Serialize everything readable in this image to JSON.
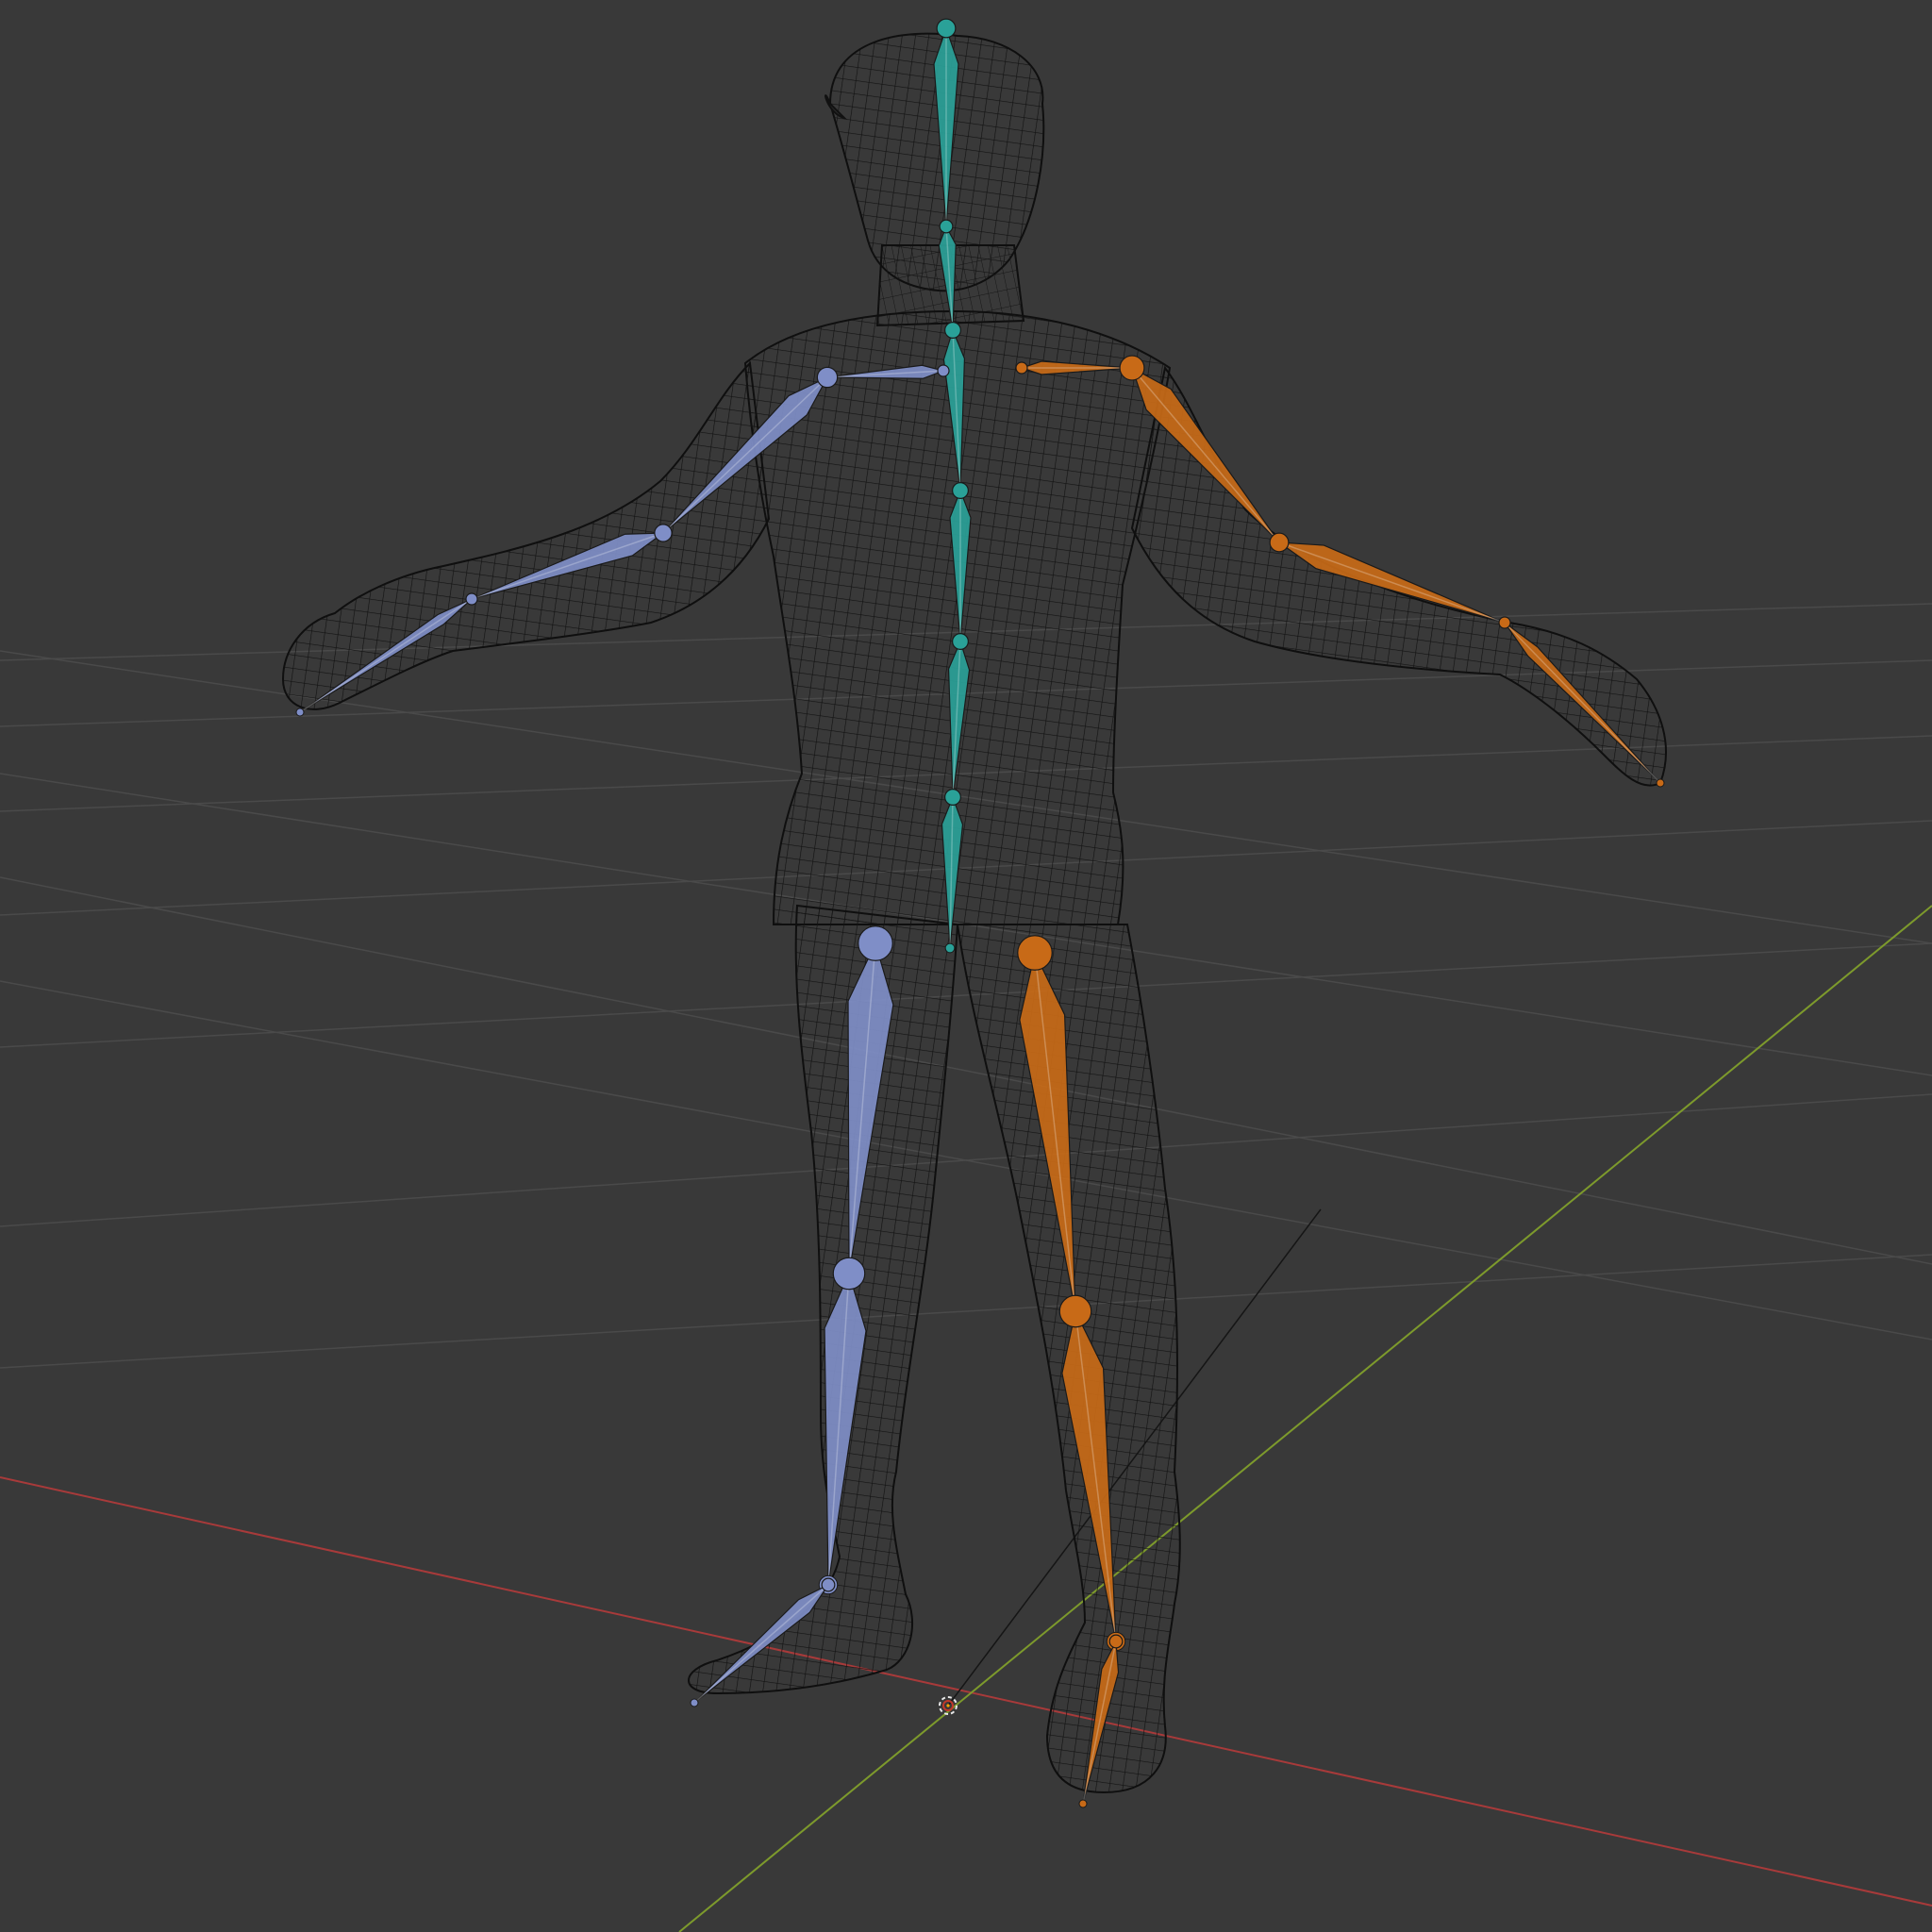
{
  "viewport": {
    "background_color": "#393939",
    "grid_color": "#4a4a4a",
    "x_axis_color": "#a83a3a",
    "y_axis_color": "#7d9a2c"
  },
  "mesh": {
    "display": "wireframe",
    "wire_color": "#111111"
  },
  "armature": {
    "center_bone_color": "#2aa198",
    "left_side_color": "#7f8ec7",
    "right_side_color": "#c86a17",
    "bones": [
      {
        "id": "head",
        "group": "center"
      },
      {
        "id": "neck",
        "group": "center"
      },
      {
        "id": "spine-upper",
        "group": "center"
      },
      {
        "id": "spine-mid",
        "group": "center"
      },
      {
        "id": "spine-lower",
        "group": "center"
      },
      {
        "id": "hips",
        "group": "center"
      },
      {
        "id": "shoulder-l",
        "group": "left"
      },
      {
        "id": "upper-arm-l",
        "group": "left"
      },
      {
        "id": "forearm-l",
        "group": "left"
      },
      {
        "id": "hand-l",
        "group": "left"
      },
      {
        "id": "thigh-l",
        "group": "left"
      },
      {
        "id": "shin-l",
        "group": "left"
      },
      {
        "id": "foot-l",
        "group": "left"
      },
      {
        "id": "shoulder-r",
        "group": "right"
      },
      {
        "id": "upper-arm-r",
        "group": "right"
      },
      {
        "id": "forearm-r",
        "group": "right"
      },
      {
        "id": "hand-r",
        "group": "right"
      },
      {
        "id": "thigh-r",
        "group": "right"
      },
      {
        "id": "shin-r",
        "group": "right"
      },
      {
        "id": "foot-r",
        "group": "right"
      }
    ]
  }
}
